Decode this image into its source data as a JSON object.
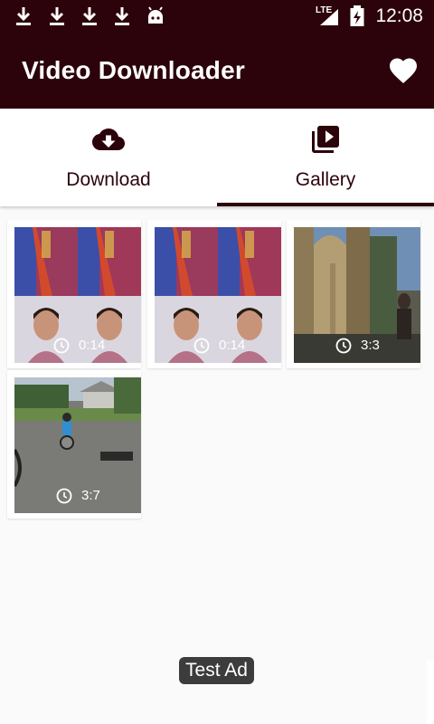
{
  "status_bar": {
    "time": "12:08",
    "network": "LTE",
    "icons": [
      "download-icon",
      "download-icon",
      "download-icon",
      "download-icon",
      "android-icon",
      "signal-icon",
      "battery-charging-icon"
    ]
  },
  "app_bar": {
    "title": "Video Downloader",
    "favorite_icon": "heart-icon"
  },
  "tabs": [
    {
      "label": "Download",
      "icon": "cloud-download-icon",
      "selected": false
    },
    {
      "label": "Gallery",
      "icon": "video-library-icon",
      "selected": true
    }
  ],
  "gallery": {
    "items": [
      {
        "duration": "0:14",
        "thumb": "saree-collage"
      },
      {
        "duration": "0:14",
        "thumb": "saree-collage"
      },
      {
        "duration": "3:3",
        "thumb": "stone-archway"
      },
      {
        "duration": "3:7",
        "thumb": "kid-on-bike"
      }
    ]
  },
  "ad": {
    "label": "Test Ad"
  },
  "colors": {
    "primary": "#2c020b",
    "background": "#fafafa",
    "surface": "#ffffff"
  }
}
